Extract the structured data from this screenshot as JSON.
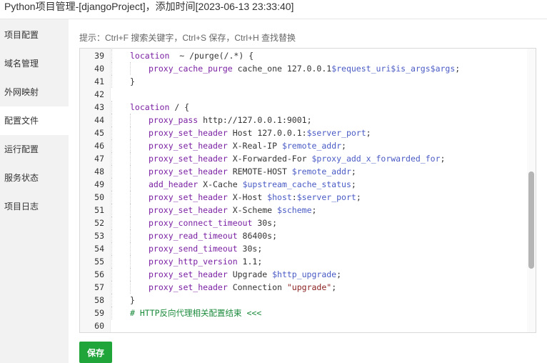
{
  "window": {
    "title": "Python项目管理-[djangoProject]，添加时间[2023-06-13 23:33:40]"
  },
  "sidebar": {
    "items": [
      {
        "label": "项目配置"
      },
      {
        "label": "域名管理"
      },
      {
        "label": "外网映射"
      },
      {
        "label": "配置文件"
      },
      {
        "label": "运行配置"
      },
      {
        "label": "服务状态"
      },
      {
        "label": "项目日志"
      }
    ],
    "active_index": 3
  },
  "editor": {
    "hint": "提示：Ctrl+F 搜索关键字，Ctrl+S 保存，Ctrl+H 查找替换",
    "lines": [
      {
        "n": "39",
        "indent": 1,
        "parts": [
          [
            "kw",
            "location"
          ],
          [
            "",
            "  ~ /purge(/.*) {"
          ]
        ]
      },
      {
        "n": "40",
        "indent": 2,
        "parts": [
          [
            "kw",
            "proxy_cache_purge"
          ],
          [
            "",
            " cache_one 127.0.0.1"
          ],
          [
            "var",
            "$request_uri$is_args$args"
          ],
          [
            "",
            ";"
          ]
        ]
      },
      {
        "n": "41",
        "indent": 1,
        "parts": [
          [
            "",
            "}"
          ]
        ]
      },
      {
        "n": "42",
        "indent": 0,
        "parts": []
      },
      {
        "n": "43",
        "indent": 1,
        "parts": [
          [
            "kw",
            "location"
          ],
          [
            "",
            " / {"
          ]
        ]
      },
      {
        "n": "44",
        "indent": 2,
        "parts": [
          [
            "kw",
            "proxy_pass"
          ],
          [
            "",
            " http://127.0.0.1:9001;"
          ]
        ]
      },
      {
        "n": "45",
        "indent": 2,
        "parts": [
          [
            "kw",
            "proxy_set_header"
          ],
          [
            "",
            " Host 127.0.0.1:"
          ],
          [
            "var",
            "$server_port"
          ],
          [
            "",
            ";"
          ]
        ]
      },
      {
        "n": "46",
        "indent": 2,
        "parts": [
          [
            "kw",
            "proxy_set_header"
          ],
          [
            "",
            " X-Real-IP "
          ],
          [
            "var",
            "$remote_addr"
          ],
          [
            "",
            ";"
          ]
        ]
      },
      {
        "n": "47",
        "indent": 2,
        "parts": [
          [
            "kw",
            "proxy_set_header"
          ],
          [
            "",
            " X-Forwarded-For "
          ],
          [
            "var",
            "$proxy_add_x_forwarded_for"
          ],
          [
            "",
            ";"
          ]
        ]
      },
      {
        "n": "48",
        "indent": 2,
        "parts": [
          [
            "kw",
            "proxy_set_header"
          ],
          [
            "",
            " REMOTE-HOST "
          ],
          [
            "var",
            "$remote_addr"
          ],
          [
            "",
            ";"
          ]
        ]
      },
      {
        "n": "49",
        "indent": 2,
        "parts": [
          [
            "kw",
            "add_header"
          ],
          [
            "",
            " X-Cache "
          ],
          [
            "var",
            "$upstream_cache_status"
          ],
          [
            "",
            ";"
          ]
        ]
      },
      {
        "n": "50",
        "indent": 2,
        "parts": [
          [
            "kw",
            "proxy_set_header"
          ],
          [
            "",
            " X-Host "
          ],
          [
            "var",
            "$host"
          ],
          [
            "",
            ":"
          ],
          [
            "var",
            "$server_port"
          ],
          [
            "",
            ";"
          ]
        ]
      },
      {
        "n": "51",
        "indent": 2,
        "parts": [
          [
            "kw",
            "proxy_set_header"
          ],
          [
            "",
            " X-Scheme "
          ],
          [
            "var",
            "$scheme"
          ],
          [
            "",
            ";"
          ]
        ]
      },
      {
        "n": "52",
        "indent": 2,
        "parts": [
          [
            "kw",
            "proxy_connect_timeout"
          ],
          [
            "",
            " 30s;"
          ]
        ]
      },
      {
        "n": "53",
        "indent": 2,
        "parts": [
          [
            "kw",
            "proxy_read_timeout"
          ],
          [
            "",
            " 86400s;"
          ]
        ]
      },
      {
        "n": "54",
        "indent": 2,
        "parts": [
          [
            "kw",
            "proxy_send_timeout"
          ],
          [
            "",
            " 30s;"
          ]
        ]
      },
      {
        "n": "55",
        "indent": 2,
        "parts": [
          [
            "kw",
            "proxy_http_version"
          ],
          [
            "",
            " 1.1;"
          ]
        ]
      },
      {
        "n": "56",
        "indent": 2,
        "parts": [
          [
            "kw",
            "proxy_set_header"
          ],
          [
            "",
            " Upgrade "
          ],
          [
            "var",
            "$http_upgrade"
          ],
          [
            "",
            ";"
          ]
        ]
      },
      {
        "n": "57",
        "indent": 2,
        "parts": [
          [
            "kw",
            "proxy_set_header"
          ],
          [
            "",
            " Connection "
          ],
          [
            "str",
            "\"upgrade\""
          ],
          [
            "",
            ";"
          ]
        ]
      },
      {
        "n": "58",
        "indent": 1,
        "parts": [
          [
            "",
            "}"
          ]
        ]
      },
      {
        "n": "59",
        "indent": 1,
        "parts": [
          [
            "cm",
            "# HTTP反向代理相关配置结束 <<<"
          ]
        ]
      },
      {
        "n": "60",
        "indent": 0,
        "parts": []
      }
    ],
    "scroll_fraction": 0.65
  },
  "actions": {
    "save_label": "保存"
  },
  "colors": {
    "accent": "#20a53a",
    "keyword": "#7a1fa2",
    "variable": "#4a5bc5",
    "string": "#8a1f1f",
    "comment": "#1a8a3b"
  }
}
